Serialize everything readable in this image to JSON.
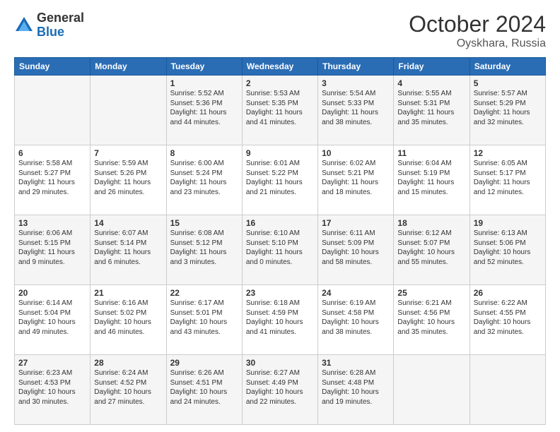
{
  "header": {
    "logo_general": "General",
    "logo_blue": "Blue",
    "month_title": "October 2024",
    "location": "Oyskhara, Russia"
  },
  "days_of_week": [
    "Sunday",
    "Monday",
    "Tuesday",
    "Wednesday",
    "Thursday",
    "Friday",
    "Saturday"
  ],
  "weeks": [
    [
      {
        "day": "",
        "info": ""
      },
      {
        "day": "",
        "info": ""
      },
      {
        "day": "1",
        "info": "Sunrise: 5:52 AM\nSunset: 5:36 PM\nDaylight: 11 hours and 44 minutes."
      },
      {
        "day": "2",
        "info": "Sunrise: 5:53 AM\nSunset: 5:35 PM\nDaylight: 11 hours and 41 minutes."
      },
      {
        "day": "3",
        "info": "Sunrise: 5:54 AM\nSunset: 5:33 PM\nDaylight: 11 hours and 38 minutes."
      },
      {
        "day": "4",
        "info": "Sunrise: 5:55 AM\nSunset: 5:31 PM\nDaylight: 11 hours and 35 minutes."
      },
      {
        "day": "5",
        "info": "Sunrise: 5:57 AM\nSunset: 5:29 PM\nDaylight: 11 hours and 32 minutes."
      }
    ],
    [
      {
        "day": "6",
        "info": "Sunrise: 5:58 AM\nSunset: 5:27 PM\nDaylight: 11 hours and 29 minutes."
      },
      {
        "day": "7",
        "info": "Sunrise: 5:59 AM\nSunset: 5:26 PM\nDaylight: 11 hours and 26 minutes."
      },
      {
        "day": "8",
        "info": "Sunrise: 6:00 AM\nSunset: 5:24 PM\nDaylight: 11 hours and 23 minutes."
      },
      {
        "day": "9",
        "info": "Sunrise: 6:01 AM\nSunset: 5:22 PM\nDaylight: 11 hours and 21 minutes."
      },
      {
        "day": "10",
        "info": "Sunrise: 6:02 AM\nSunset: 5:21 PM\nDaylight: 11 hours and 18 minutes."
      },
      {
        "day": "11",
        "info": "Sunrise: 6:04 AM\nSunset: 5:19 PM\nDaylight: 11 hours and 15 minutes."
      },
      {
        "day": "12",
        "info": "Sunrise: 6:05 AM\nSunset: 5:17 PM\nDaylight: 11 hours and 12 minutes."
      }
    ],
    [
      {
        "day": "13",
        "info": "Sunrise: 6:06 AM\nSunset: 5:15 PM\nDaylight: 11 hours and 9 minutes."
      },
      {
        "day": "14",
        "info": "Sunrise: 6:07 AM\nSunset: 5:14 PM\nDaylight: 11 hours and 6 minutes."
      },
      {
        "day": "15",
        "info": "Sunrise: 6:08 AM\nSunset: 5:12 PM\nDaylight: 11 hours and 3 minutes."
      },
      {
        "day": "16",
        "info": "Sunrise: 6:10 AM\nSunset: 5:10 PM\nDaylight: 11 hours and 0 minutes."
      },
      {
        "day": "17",
        "info": "Sunrise: 6:11 AM\nSunset: 5:09 PM\nDaylight: 10 hours and 58 minutes."
      },
      {
        "day": "18",
        "info": "Sunrise: 6:12 AM\nSunset: 5:07 PM\nDaylight: 10 hours and 55 minutes."
      },
      {
        "day": "19",
        "info": "Sunrise: 6:13 AM\nSunset: 5:06 PM\nDaylight: 10 hours and 52 minutes."
      }
    ],
    [
      {
        "day": "20",
        "info": "Sunrise: 6:14 AM\nSunset: 5:04 PM\nDaylight: 10 hours and 49 minutes."
      },
      {
        "day": "21",
        "info": "Sunrise: 6:16 AM\nSunset: 5:02 PM\nDaylight: 10 hours and 46 minutes."
      },
      {
        "day": "22",
        "info": "Sunrise: 6:17 AM\nSunset: 5:01 PM\nDaylight: 10 hours and 43 minutes."
      },
      {
        "day": "23",
        "info": "Sunrise: 6:18 AM\nSunset: 4:59 PM\nDaylight: 10 hours and 41 minutes."
      },
      {
        "day": "24",
        "info": "Sunrise: 6:19 AM\nSunset: 4:58 PM\nDaylight: 10 hours and 38 minutes."
      },
      {
        "day": "25",
        "info": "Sunrise: 6:21 AM\nSunset: 4:56 PM\nDaylight: 10 hours and 35 minutes."
      },
      {
        "day": "26",
        "info": "Sunrise: 6:22 AM\nSunset: 4:55 PM\nDaylight: 10 hours and 32 minutes."
      }
    ],
    [
      {
        "day": "27",
        "info": "Sunrise: 6:23 AM\nSunset: 4:53 PM\nDaylight: 10 hours and 30 minutes."
      },
      {
        "day": "28",
        "info": "Sunrise: 6:24 AM\nSunset: 4:52 PM\nDaylight: 10 hours and 27 minutes."
      },
      {
        "day": "29",
        "info": "Sunrise: 6:26 AM\nSunset: 4:51 PM\nDaylight: 10 hours and 24 minutes."
      },
      {
        "day": "30",
        "info": "Sunrise: 6:27 AM\nSunset: 4:49 PM\nDaylight: 10 hours and 22 minutes."
      },
      {
        "day": "31",
        "info": "Sunrise: 6:28 AM\nSunset: 4:48 PM\nDaylight: 10 hours and 19 minutes."
      },
      {
        "day": "",
        "info": ""
      },
      {
        "day": "",
        "info": ""
      }
    ]
  ]
}
